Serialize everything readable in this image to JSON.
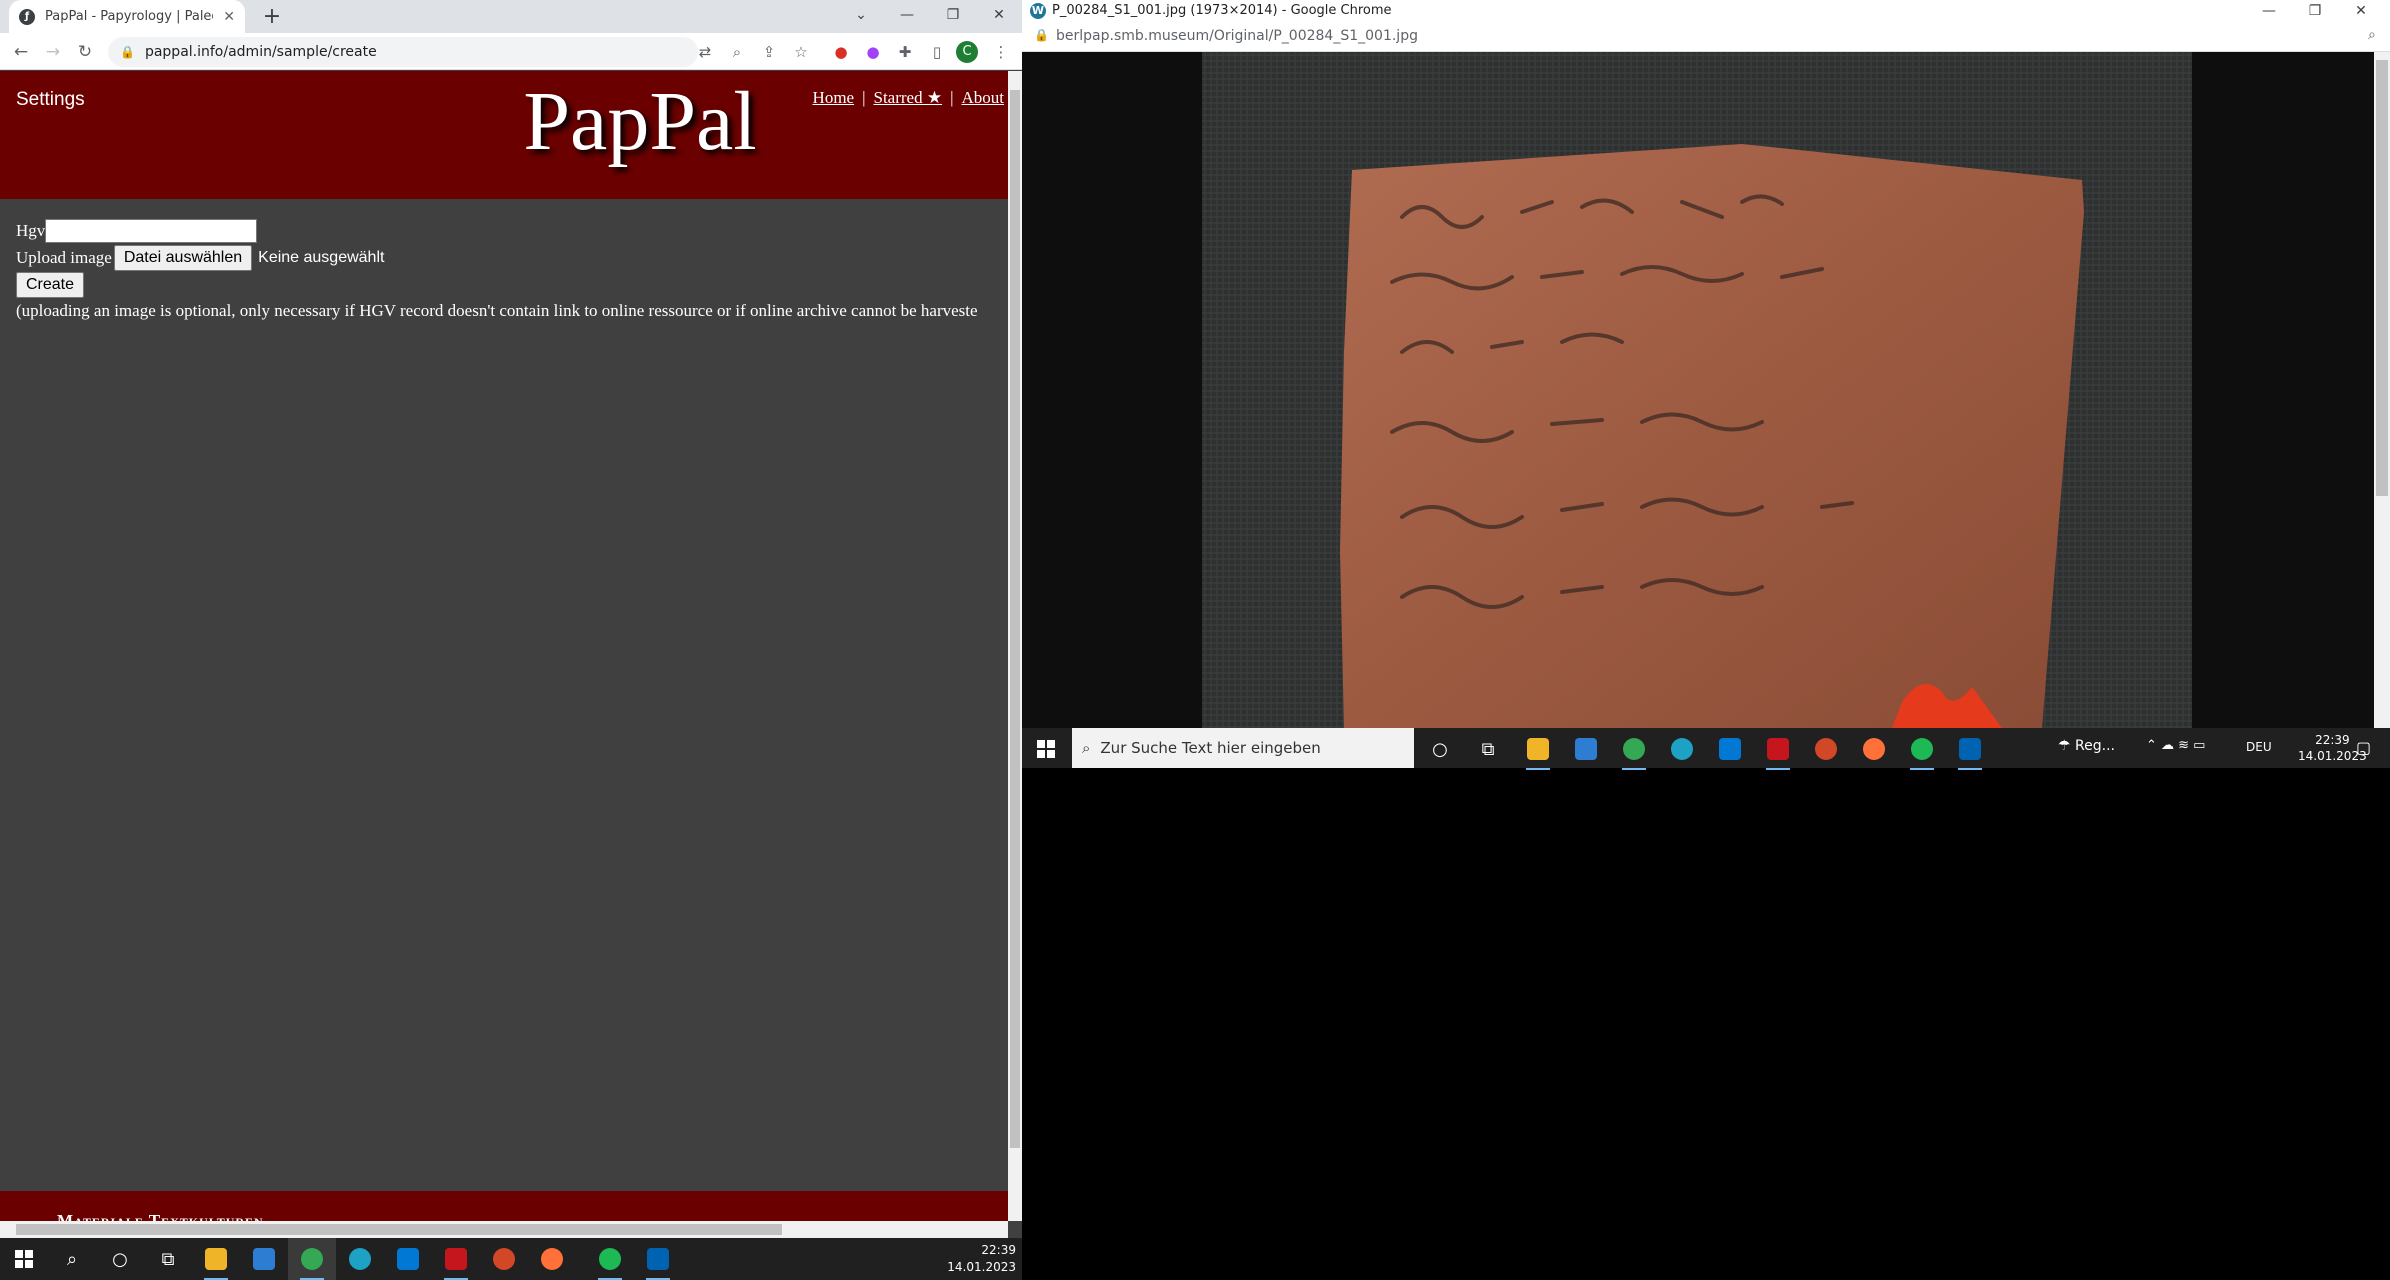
{
  "left_window": {
    "tab_title": "PapPal - Papyrology | Paleograph",
    "url": "pappal.info/admin/sample/create"
  },
  "pappal": {
    "settings_label": "Settings",
    "logo": "PapPal",
    "nav": {
      "home": "Home",
      "starred": "Starred ★",
      "about": "About"
    },
    "form": {
      "hgv_label": "Hgv",
      "upload_label": "Upload image",
      "file_button": "Datei auswählen",
      "file_status": "Keine ausgewählt",
      "create_button": "Create",
      "note": "(uploading an image is optional, only necessary if HGV record doesn't contain link to online ressource or if online archive cannot be harveste"
    },
    "footer_text": "Materiale Textkulturen"
  },
  "right_window": {
    "title": "P_00284_S1_001.jpg (1973×2014) - Google Chrome",
    "url": "berlpap.smb.museum/Original/P_00284_S1_001.jpg"
  },
  "right_taskbar": {
    "search_placeholder": "Zur Suche Text hier eingeben",
    "weather": "Reg...",
    "language": "DEU",
    "time": "22:39",
    "date": "14.01.2023"
  },
  "taskbar": {
    "time": "22:39",
    "date": "14.01.2023"
  },
  "colors": {
    "pappal_red": "#6b0000",
    "page_bg": "#404040"
  }
}
